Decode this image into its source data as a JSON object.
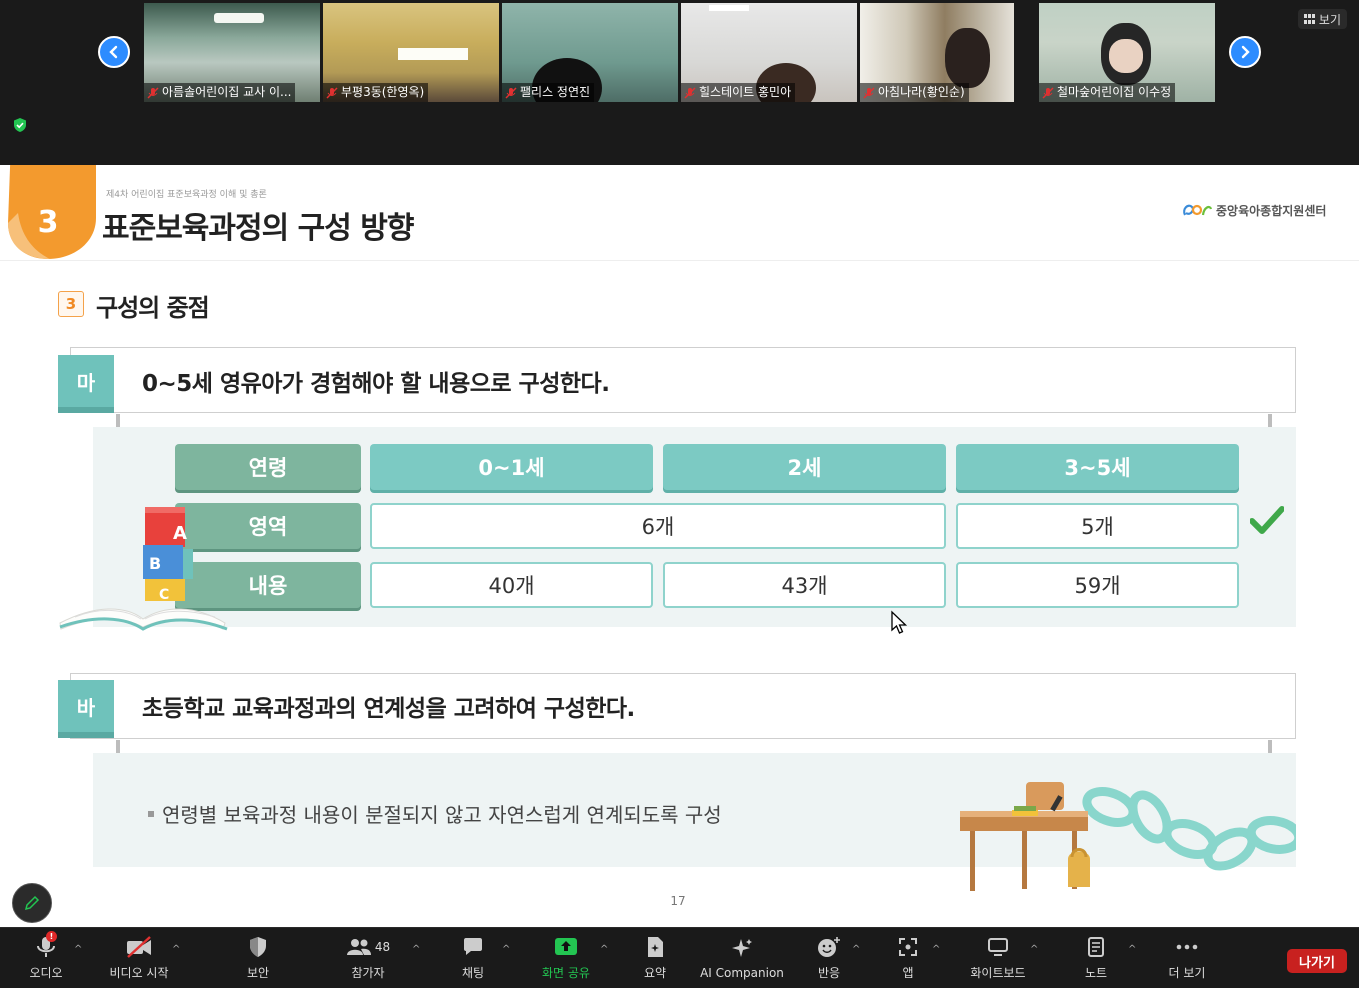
{
  "app": {
    "view_label": "보기"
  },
  "participants": [
    {
      "name": "아름솔어린이집 교사 이..."
    },
    {
      "name": "부평3동(한영옥)"
    },
    {
      "name": "팰리스 정연진"
    },
    {
      "name": "힐스테이트 홍민아"
    },
    {
      "name": "아침나라(황인순)"
    },
    {
      "name": "철마숲어린이집 이수정"
    }
  ],
  "slide": {
    "number": "3",
    "small_subtitle": "제4차 어린이집 표준보육과정 이해 및 총론",
    "title": "표준보육과정의 구성 방향",
    "logo_text": "중앙육아종합지원센터",
    "section_number": "3",
    "section_title": "구성의 중점",
    "point_ma": {
      "tab": "마",
      "text": "0~5세 영유아가 경험해야 할 내용으로 구성한다."
    },
    "table": {
      "row_age": "연령",
      "row_area": "영역",
      "row_content": "내용",
      "col_0_1": "0~1세",
      "col_2": "2세",
      "col_3_5": "3~5세",
      "area_0_2": "6개",
      "area_3_5": "5개",
      "content_0_1": "40개",
      "content_2": "43개",
      "content_3_5": "59개"
    },
    "point_ba": {
      "tab": "바",
      "text": "초등학교 교육과정과의 연계성을 고려하여 구성한다."
    },
    "bullet": "연령별 보육과정 내용이 분절되지 않고 자연스럽게 연계되도록 구성",
    "page_number": "17",
    "blocks": [
      "A",
      "B",
      "C"
    ]
  },
  "toolbar": {
    "audio": "오디오",
    "audio_badge": "!",
    "video": "비디오 시작",
    "security": "보안",
    "participants": "참가자",
    "participants_count": "48",
    "chat": "채팅",
    "share": "화면 공유",
    "summary": "요약",
    "ai": "AI Companion",
    "reactions": "반응",
    "apps": "앱",
    "whiteboard": "화이트보드",
    "notes": "노트",
    "more": "더 보기",
    "leave": "나가기"
  },
  "colors": {
    "accent": "#2d8cff",
    "share_green": "#23c552",
    "leave_red": "#c8211f",
    "teal": "#7ccac3",
    "orange": "#f39a2e"
  }
}
